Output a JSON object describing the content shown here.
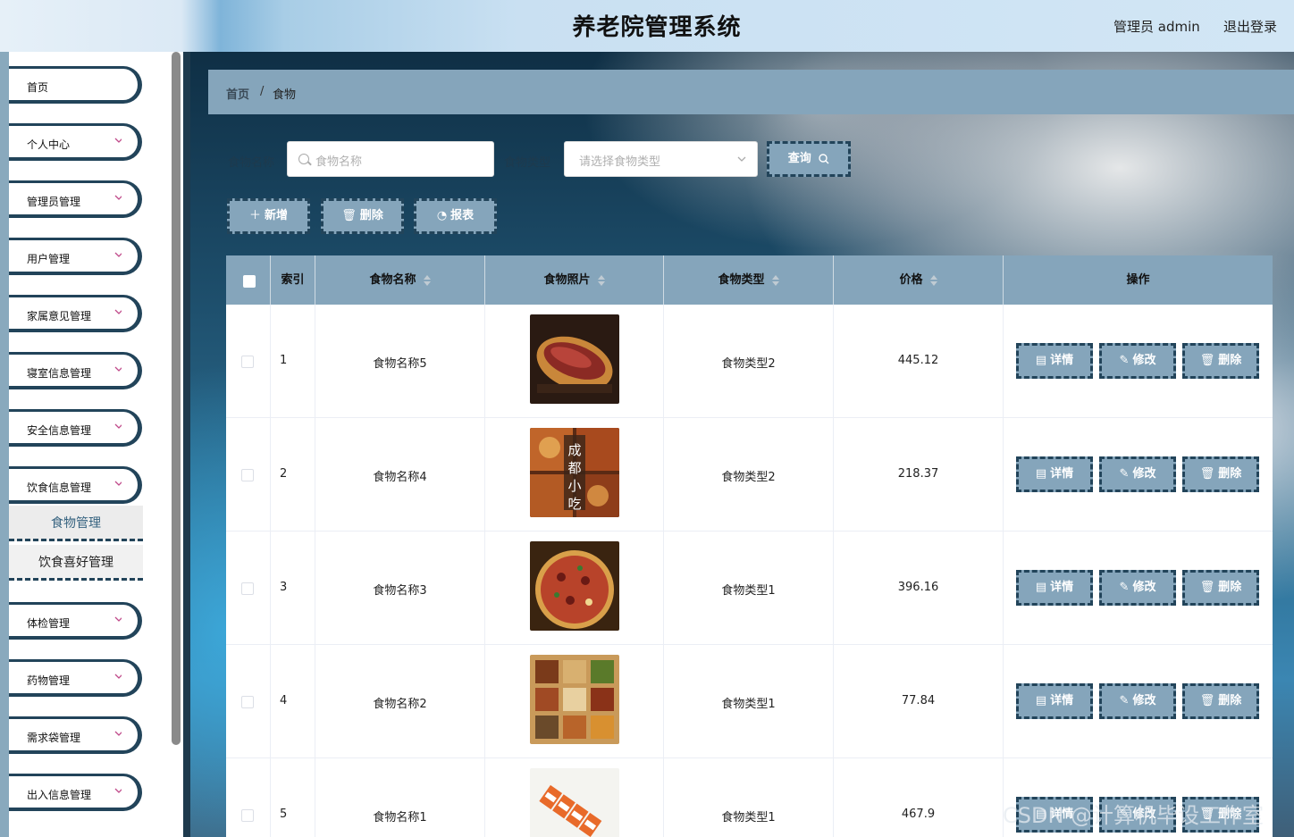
{
  "header": {
    "title": "养老院管理系统",
    "user": "管理员 admin",
    "logout": "退出登录"
  },
  "sidebar": {
    "items": [
      {
        "label": "首页",
        "has_arrow": false
      },
      {
        "label": "个人中心",
        "has_arrow": true
      },
      {
        "label": "管理员管理",
        "has_arrow": true
      },
      {
        "label": "用户管理",
        "has_arrow": true
      },
      {
        "label": "家属意见管理",
        "has_arrow": true
      },
      {
        "label": "寝室信息管理",
        "has_arrow": true
      },
      {
        "label": "安全信息管理",
        "has_arrow": true
      },
      {
        "label": "饮食信息管理",
        "has_arrow": true
      },
      {
        "label": "体检管理",
        "has_arrow": true
      },
      {
        "label": "药物管理",
        "has_arrow": true
      },
      {
        "label": "需求袋管理",
        "has_arrow": true
      },
      {
        "label": "出入信息管理",
        "has_arrow": true
      }
    ],
    "subitems": [
      {
        "label": "食物管理",
        "active": true
      },
      {
        "label": "饮食喜好管理",
        "active": false
      }
    ]
  },
  "breadcrumb": {
    "home": "首页",
    "separator": "/",
    "current": "食物"
  },
  "search": {
    "name_label": "食物名称",
    "name_placeholder": "食物名称",
    "type_label": "食物类型",
    "type_placeholder": "请选择食物类型",
    "query_button": "查询"
  },
  "actions": {
    "add": "新增",
    "delete": "删除",
    "report": "报表"
  },
  "table": {
    "columns": [
      "索引",
      "食物名称",
      "食物照片",
      "食物类型",
      "价格",
      "操作"
    ],
    "rows": [
      {
        "index": "1",
        "name": "食物名称5",
        "photo": "sandwich",
        "type": "食物类型2",
        "price": "445.12"
      },
      {
        "index": "2",
        "name": "食物名称4",
        "photo": "chengdu-snacks",
        "type": "食物类型2",
        "price": "218.37"
      },
      {
        "index": "3",
        "name": "食物名称3",
        "photo": "pizza",
        "type": "食物类型1",
        "price": "396.16"
      },
      {
        "index": "4",
        "name": "食物名称2",
        "photo": "bento-box",
        "type": "食物类型1",
        "price": "77.84"
      },
      {
        "index": "5",
        "name": "食物名称1",
        "photo": "sushi-rolls",
        "type": "食物类型1",
        "price": "467.9"
      }
    ],
    "row_actions": {
      "detail": "详情",
      "edit": "修改",
      "delete": "删除"
    },
    "photo_overlay_text": "成都小吃"
  },
  "watermark": "CSDN @计算机毕设工作室",
  "colors": {
    "accent": "#85a5bb",
    "dark": "#22445a"
  }
}
